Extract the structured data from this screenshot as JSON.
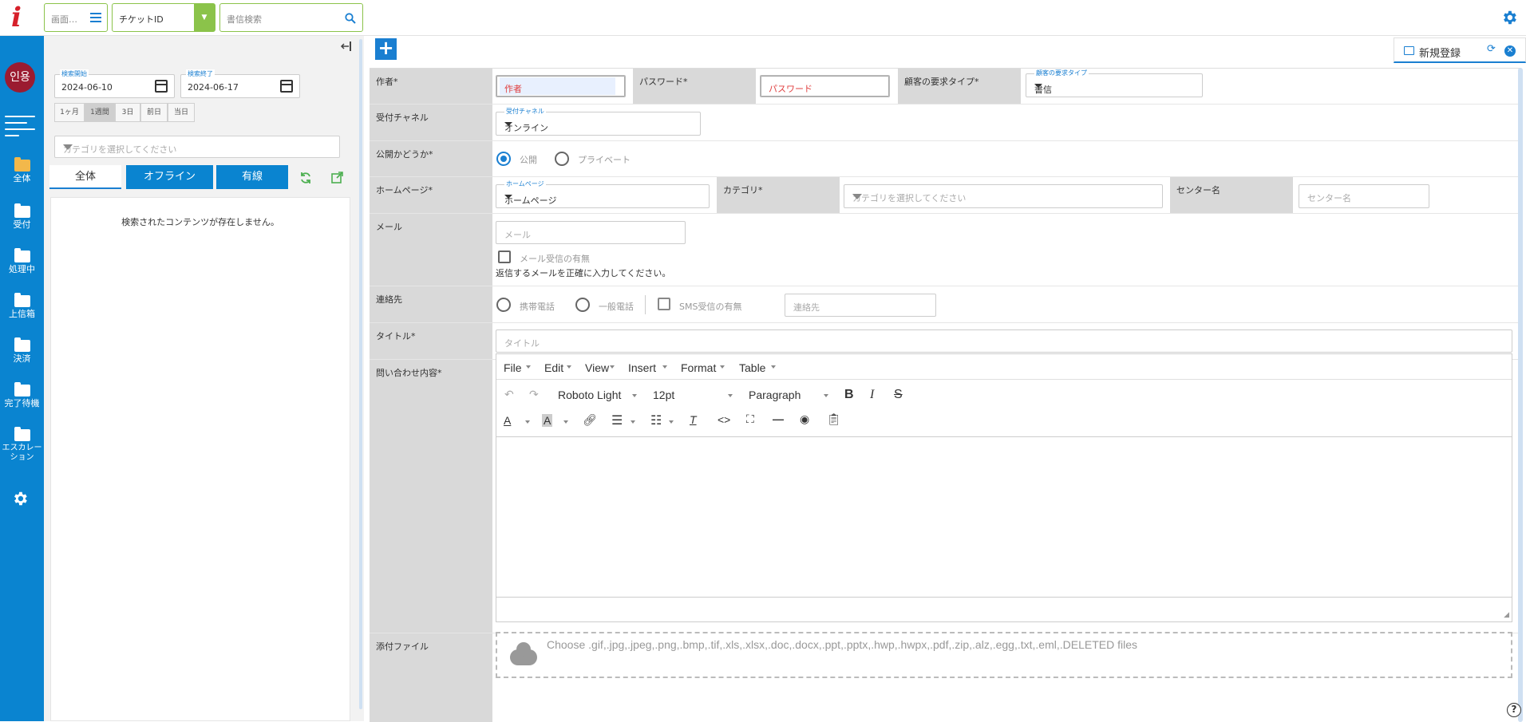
{
  "topbar": {
    "screen_select_label": "画面…",
    "ticket_type_label": "チケットID",
    "search_placeholder": "書信検索"
  },
  "nav": {
    "avatar_text": "인용",
    "items": [
      {
        "label": "全体",
        "icon": "folder-open-icon"
      },
      {
        "label": "受付",
        "icon": "folder-icon"
      },
      {
        "label": "処理中",
        "icon": "folder-icon"
      },
      {
        "label": "上信箱",
        "icon": "folder-icon"
      },
      {
        "label": "決済",
        "icon": "folder-icon"
      },
      {
        "label": "完了待機",
        "icon": "folder-icon"
      },
      {
        "label": "エスカレーション",
        "icon": "folder-icon"
      }
    ],
    "settings_icon": "gear-icon"
  },
  "left_panel": {
    "start_date": {
      "label": "検索開始",
      "value": "2024-06-10"
    },
    "end_date": {
      "label": "検索終了",
      "value": "2024-06-17"
    },
    "ranges": [
      "1ヶ月",
      "1週間",
      "3日",
      "前日",
      "当日"
    ],
    "selected_range": "1週間",
    "category_placeholder": "カテゴリを選択してください",
    "tabs": {
      "all": "全体",
      "offline": "オフライン",
      "wired": "有線"
    },
    "empty_message": "検索されたコンテンツが存在しません。"
  },
  "main": {
    "tab_title": "新規登録",
    "form": {
      "author": {
        "label": "作者*",
        "placeholder": "作者"
      },
      "password": {
        "label": "パスワード*",
        "placeholder": "パスワード"
      },
      "request_type": {
        "label": "顧客の要求タイプ*",
        "float_label": "顧客の要求タイプ",
        "value": "書信"
      },
      "channel": {
        "label": "受付チャネル",
        "float_label": "受付チャネル",
        "value": "オンライン"
      },
      "visibility": {
        "label": "公開かどうか*",
        "options": [
          "公開",
          "プライベート"
        ],
        "selected": "公開"
      },
      "homepage": {
        "label": "ホームページ*",
        "float_label": "ホームページ",
        "value": "ホームページ"
      },
      "category": {
        "label": "カテゴリ*",
        "placeholder": "カテゴリを選択してください"
      },
      "center": {
        "label": "センター名",
        "placeholder": "センター名"
      },
      "email": {
        "label": "メール",
        "placeholder": "メール",
        "receive_label": "メール受信の有無",
        "note": "返信するメールを正確に入力してください。"
      },
      "contact": {
        "label": "連絡先",
        "options": [
          "携帯電話",
          "一般電話"
        ],
        "sms_label": "SMS受信の有無",
        "placeholder": "連絡先"
      },
      "title": {
        "label": "タイトル*",
        "placeholder": "タイトル"
      },
      "content": {
        "label": "問い合わせ内容*"
      },
      "attachment": {
        "label": "添付ファイル",
        "dropzone_text": "Choose .gif,.jpg,.jpeg,.png,.bmp,.tif,.xls,.xlsx,.doc,.docx,.ppt,.pptx,.hwp,.hwpx,.pdf,.zip,.alz,.egg,.txt,.eml,.DELETED files"
      }
    },
    "editor": {
      "menus": [
        "File",
        "Edit",
        "View",
        "Insert",
        "Format",
        "Table"
      ],
      "font": "Roboto Light",
      "size": "12pt",
      "block": "Paragraph"
    }
  },
  "colors": {
    "brand_blue": "#0a84d0",
    "accent_green": "#8bc34a",
    "logo_red": "#d6202a"
  }
}
